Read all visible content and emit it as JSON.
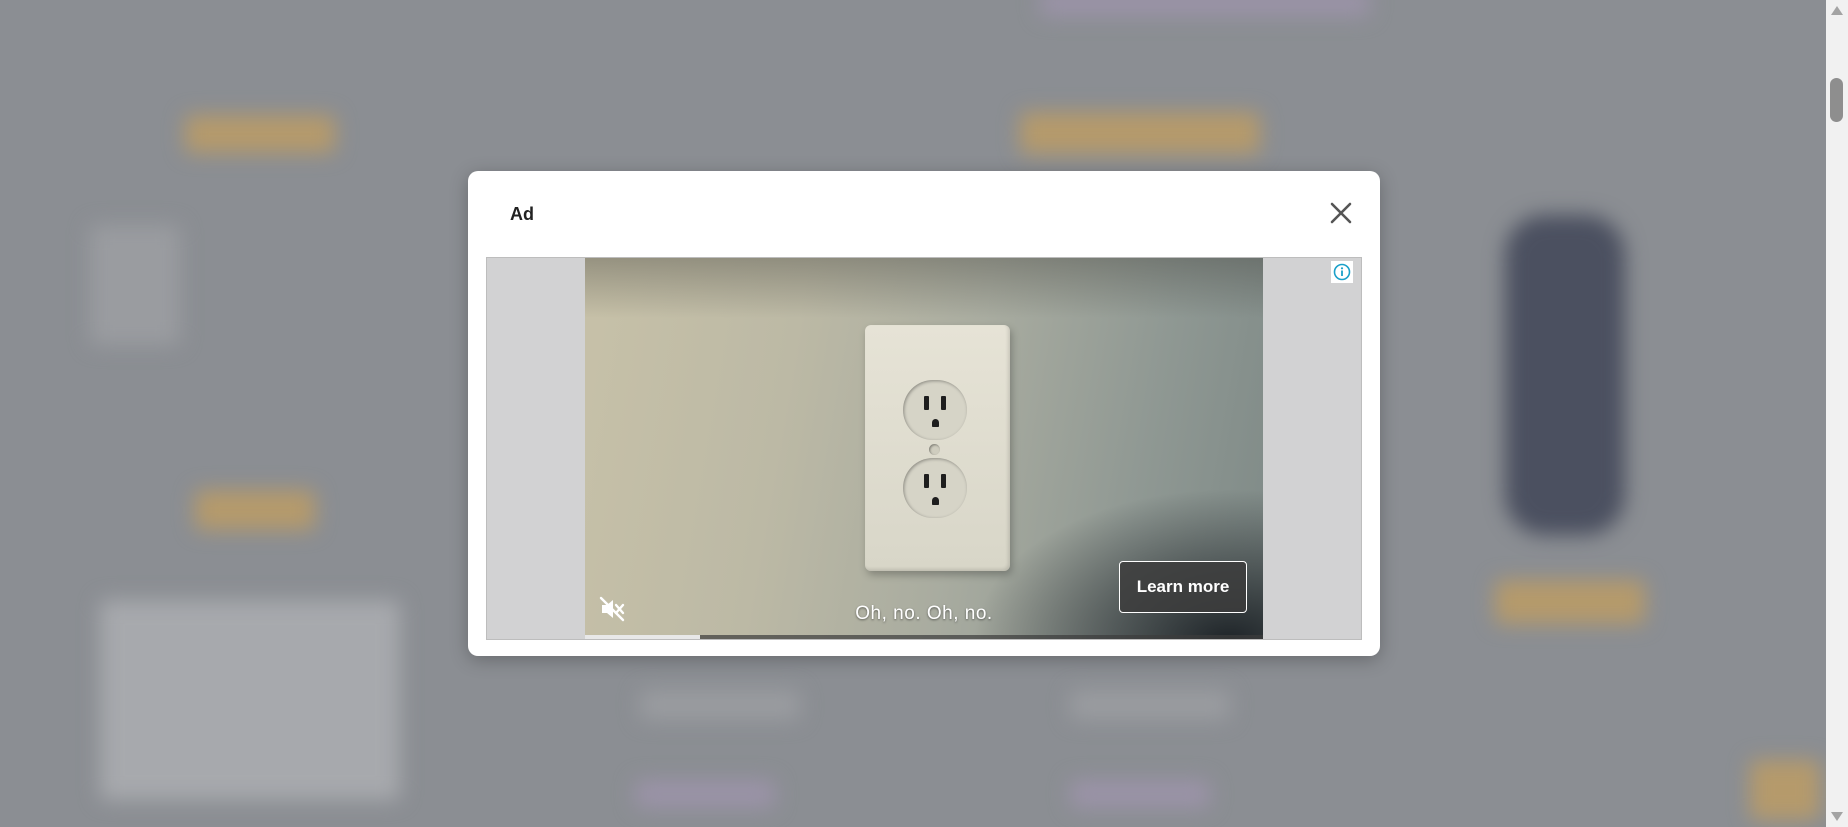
{
  "modal": {
    "title": "Ad",
    "close_icon": "close-icon"
  },
  "ad": {
    "info_icon": "info-icon",
    "caption": "Oh, no. Oh, no.",
    "cta_label": "Learn more",
    "mute_icon": "muted-speaker-icon",
    "progress_fraction": 0.17
  },
  "colors": {
    "overlay": "#8b8e93",
    "info_accent": "#1aa0c9",
    "button_bg": "#3c3c3c"
  }
}
